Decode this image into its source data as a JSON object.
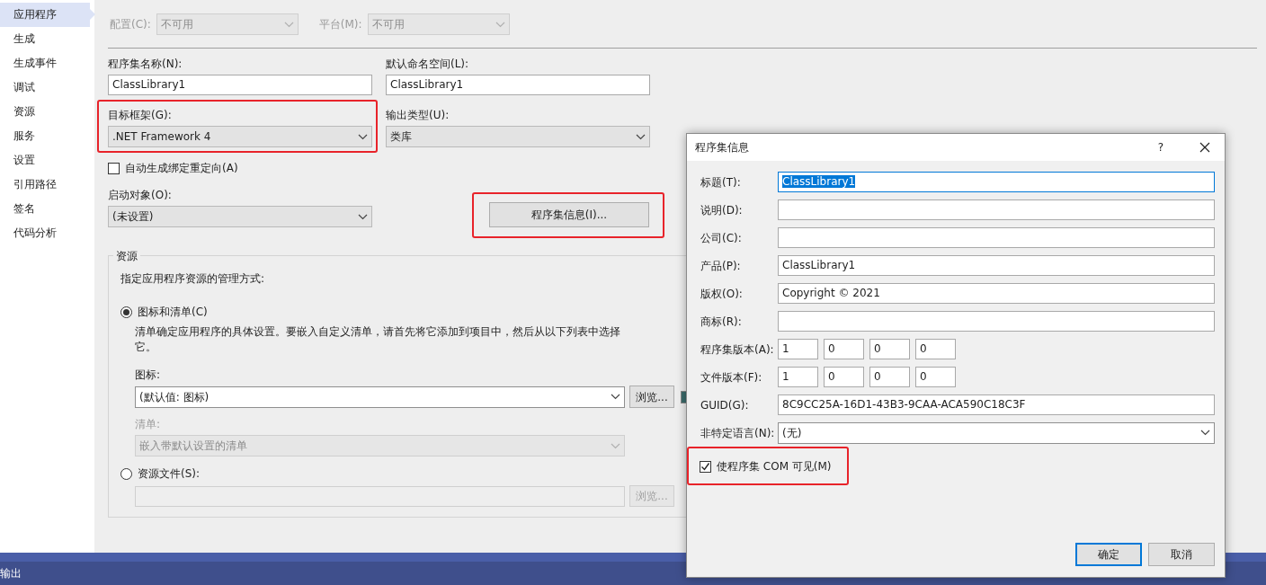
{
  "sidebar": {
    "items": [
      {
        "label": "应用程序",
        "selected": true
      },
      {
        "label": "生成",
        "selected": false
      },
      {
        "label": "生成事件",
        "selected": false
      },
      {
        "label": "调试",
        "selected": false
      },
      {
        "label": "资源",
        "selected": false
      },
      {
        "label": "服务",
        "selected": false
      },
      {
        "label": "设置",
        "selected": false
      },
      {
        "label": "引用路径",
        "selected": false
      },
      {
        "label": "签名",
        "selected": false
      },
      {
        "label": "代码分析",
        "selected": false
      }
    ]
  },
  "config": {
    "label": "配置(C):",
    "value": "不可用",
    "disabled": true
  },
  "platform": {
    "label": "平台(M):",
    "value": "不可用",
    "disabled": true
  },
  "assembly_name": {
    "label": "程序集名称(N):",
    "value": "ClassLibrary1"
  },
  "default_namespace": {
    "label": "默认命名空间(L):",
    "value": "ClassLibrary1"
  },
  "target_framework": {
    "label": "目标框架(G):",
    "value": ".NET Framework 4",
    "highlighted": true
  },
  "output_type": {
    "label": "输出类型(U):",
    "value": "类库"
  },
  "auto_binding": {
    "label": "自动生成绑定重定向(A)",
    "checked": false
  },
  "startup_object": {
    "label": "启动对象(O):",
    "value": "(未设置)"
  },
  "assembly_info_button": {
    "label": "程序集信息(I)...",
    "highlighted": true
  },
  "resources": {
    "title": "资源",
    "description": "指定应用程序资源的管理方式:",
    "options": [
      {
        "label": "图标和清单(C)",
        "selected": true
      },
      {
        "label": "资源文件(S):",
        "selected": false
      }
    ],
    "note": "清单确定应用程序的具体设置。要嵌入自定义清单，请首先将它添加到项目中，然后从以下列表中选择它。",
    "icon": {
      "label": "图标:",
      "value": "(默认值: 图标)",
      "browse": "浏览...",
      "disabled": false
    },
    "manifest": {
      "label": "清单:",
      "value": "嵌入带默认设置的清单",
      "disabled": true
    },
    "resource_file": {
      "browse": "浏览...",
      "disabled": true
    }
  },
  "output_bar": {
    "title": "输出"
  },
  "dialog": {
    "title": "程序集信息",
    "help": "?",
    "fields": [
      {
        "label": "标题(T):",
        "value": "ClassLibrary1",
        "focused": true
      },
      {
        "label": "说明(D):",
        "focused": false
      },
      {
        "label": "公司(C):",
        "focused": false
      },
      {
        "label": "产品(P):",
        "value": "ClassLibrary1",
        "focused": false
      },
      {
        "label": "版权(O):",
        "value": "Copyright ©  2021",
        "focused": false
      },
      {
        "label": "商标(R):",
        "focused": false
      }
    ],
    "versions": [
      {
        "label": "程序集版本(A):",
        "parts": [
          "1",
          "0",
          "0",
          "0"
        ]
      },
      {
        "label": "文件版本(F):",
        "parts": [
          "1",
          "0",
          "0",
          "0"
        ]
      }
    ],
    "guid": {
      "label": "GUID(G):",
      "value": "8C9CC25A-16D1-43B3-9CAA-ACA590C18C3F"
    },
    "language": {
      "label": "非特定语言(N):",
      "value": "(无)"
    },
    "com_visible": {
      "label": "使程序集 COM 可见(M)",
      "checked": true,
      "highlighted": true
    },
    "buttons": [
      {
        "label": "确定",
        "default": true
      },
      {
        "label": "取消",
        "default": false
      }
    ]
  }
}
